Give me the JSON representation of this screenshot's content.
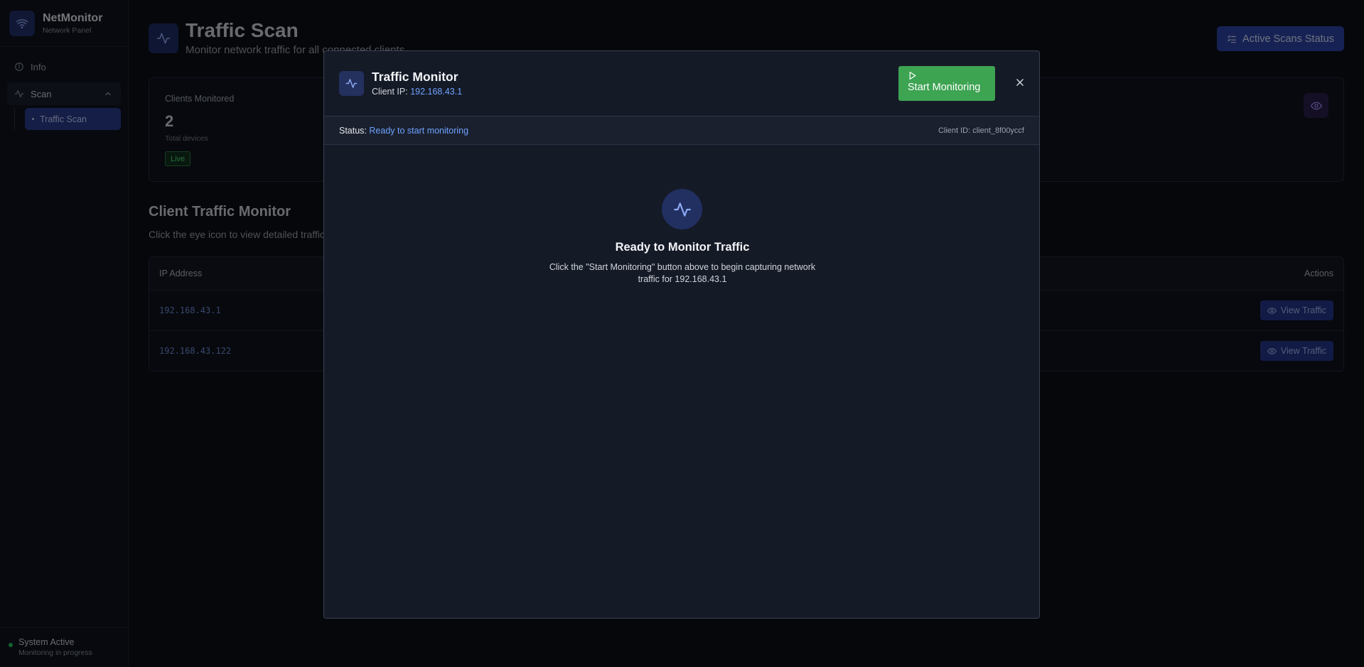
{
  "app": {
    "name": "NetMonitor",
    "subtitle": "Network Panel"
  },
  "sidebar": {
    "items": [
      {
        "label": "Info",
        "icon": "info-icon"
      },
      {
        "label": "Scan",
        "icon": "activity-icon",
        "expanded": true
      }
    ],
    "subitems": [
      {
        "label": "Traffic Scan",
        "active": true
      }
    ],
    "status": {
      "title": "System Active",
      "subtitle": "Monitoring in progress",
      "color": "#22c55e"
    }
  },
  "page": {
    "title": "Traffic Scan",
    "subtitle": "Monitor network traffic for all connected clients",
    "active_scans_button": "Active Scans Status"
  },
  "stats": {
    "label": "Clients Monitored",
    "value": "2",
    "description": "Total devices",
    "badge": "Live"
  },
  "section": {
    "title": "Client Traffic Monitor",
    "subtitle": "Click the eye icon to view detailed traffic"
  },
  "table": {
    "headers": {
      "ip": "IP Address",
      "actions": "Actions"
    },
    "rows": [
      {
        "ip": "192.168.43.1",
        "action": "View Traffic"
      },
      {
        "ip": "192.168.43.122",
        "action": "View Traffic"
      }
    ]
  },
  "modal": {
    "title": "Traffic Monitor",
    "client_ip_label": "Client IP:",
    "client_ip": "192.168.43.1",
    "start_button": "Start Monitoring",
    "status_label": "Status:",
    "status_value": "Ready to start monitoring",
    "client_id": "Client ID: client_8f00yccf",
    "empty_title": "Ready to Monitor Traffic",
    "empty_description": "Click the \"Start Monitoring\" button above to begin capturing network traffic for 192.168.43.1"
  },
  "colors": {
    "accent": "#2e44a8",
    "success": "#3da452",
    "link": "#6ea3ff",
    "background": "#0b0e15"
  }
}
